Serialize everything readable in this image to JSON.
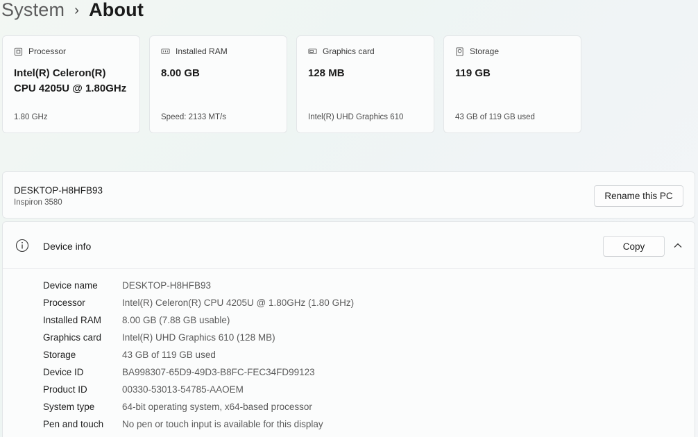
{
  "breadcrumb": {
    "parent": "System",
    "separator": "›",
    "current": "About"
  },
  "specs": [
    {
      "icon": "processor-icon",
      "label": "Processor",
      "value_line1": "Intel(R) Celeron(R)",
      "value_line2": "CPU 4205U @ 1.80GHz",
      "detail": "1.80 GHz"
    },
    {
      "icon": "ram-icon",
      "label": "Installed RAM",
      "value_line1": "8.00 GB",
      "value_line2": "",
      "detail": "Speed: 2133 MT/s"
    },
    {
      "icon": "graphics-card-icon",
      "label": "Graphics card",
      "value_line1": "128 MB",
      "value_line2": "",
      "detail": "Intel(R) UHD Graphics 610"
    },
    {
      "icon": "storage-icon",
      "label": "Storage",
      "value_line1": "119 GB",
      "value_line2": "",
      "detail": "43 GB of 119 GB used"
    }
  ],
  "pc": {
    "name": "DESKTOP-H8HFB93",
    "model": "Inspiron 3580",
    "rename_label": "Rename this PC"
  },
  "device_info": {
    "title": "Device info",
    "copy_label": "Copy",
    "rows": [
      {
        "label": "Device name",
        "value": "DESKTOP-H8HFB93"
      },
      {
        "label": "Processor",
        "value": "Intel(R) Celeron(R) CPU 4205U @ 1.80GHz (1.80 GHz)"
      },
      {
        "label": "Installed RAM",
        "value": "8.00 GB (7.88 GB usable)"
      },
      {
        "label": "Graphics card",
        "value": "Intel(R) UHD Graphics 610 (128 MB)"
      },
      {
        "label": "Storage",
        "value": "43 GB of 119 GB used"
      },
      {
        "label": "Device ID",
        "value": "BA998307-65D9-49D3-B8FC-FEC34FD99123"
      },
      {
        "label": "Product ID",
        "value": "00330-53013-54785-AAOEM"
      },
      {
        "label": "System type",
        "value": "64-bit operating system, x64-based processor"
      },
      {
        "label": "Pen and touch",
        "value": "No pen or touch input is available for this display"
      }
    ]
  }
}
